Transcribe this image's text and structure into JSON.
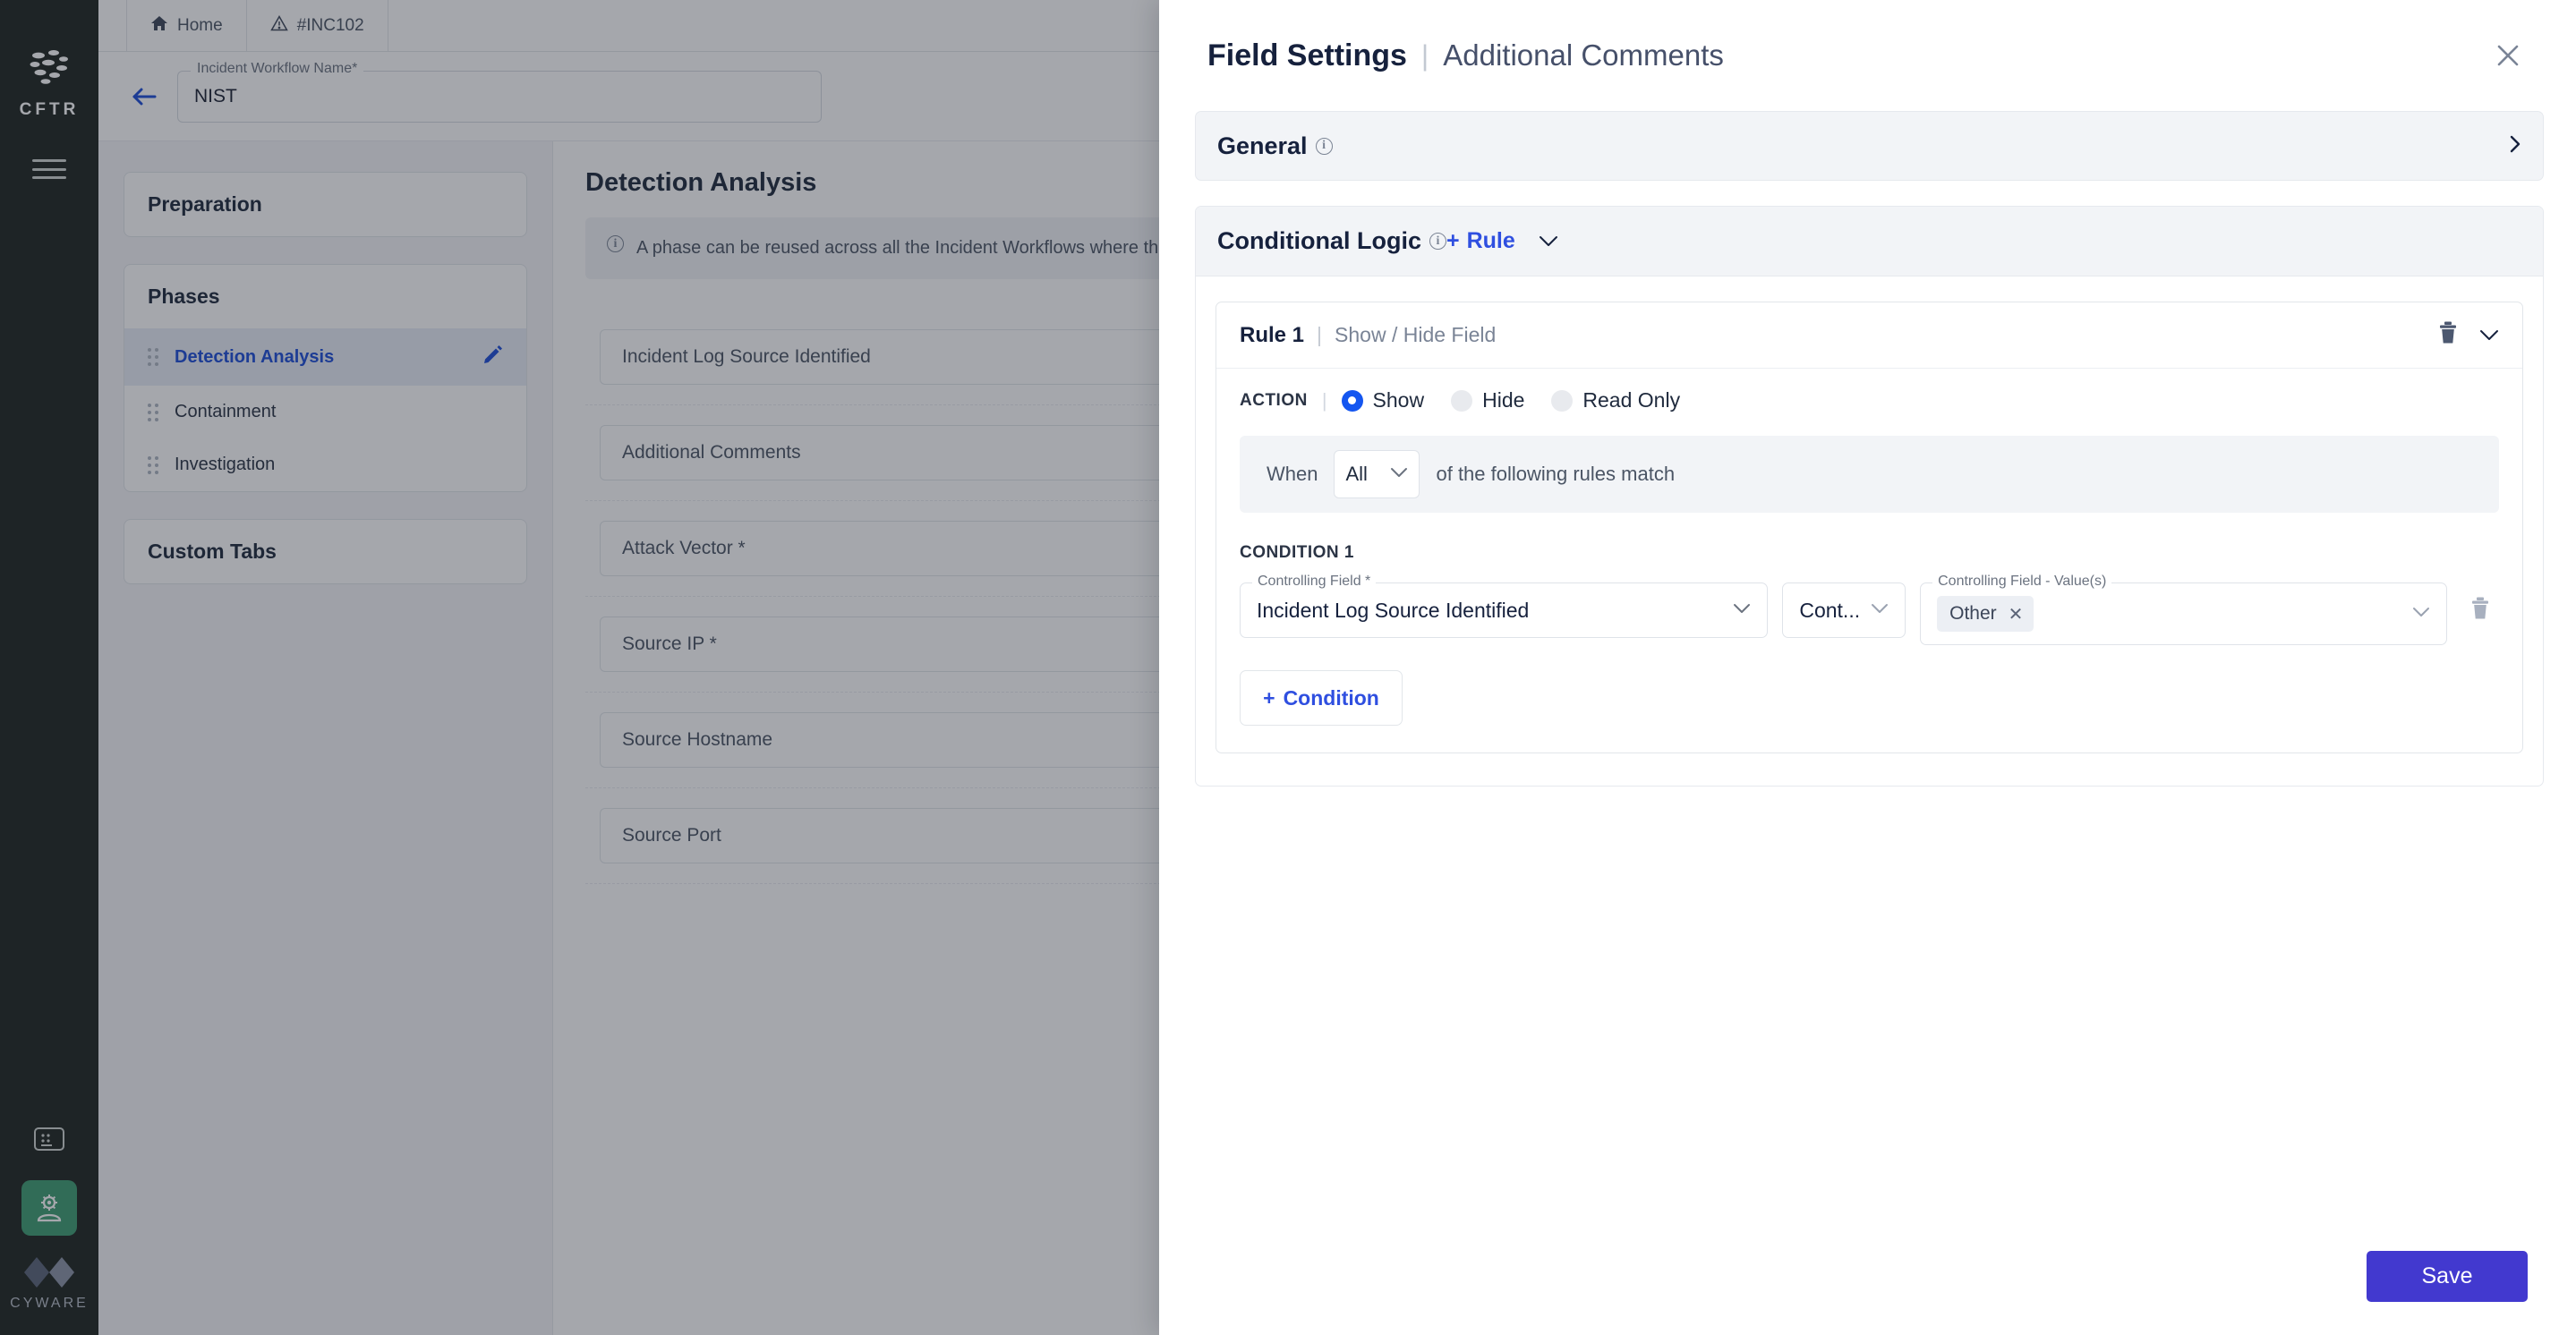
{
  "rail": {
    "logo_text": "CFTR",
    "logo_icon": "cluster-logo-icon",
    "menu_icon": "hamburger-menu-icon",
    "items": [
      {
        "icon": "console-icon",
        "active": false
      },
      {
        "icon": "admin-settings-icon",
        "active": true
      }
    ],
    "brand_text": "CYWARE",
    "brand_icon": "cyware-logo-icon"
  },
  "topbar": {
    "tabs": [
      {
        "label": "Home",
        "icon": "home-icon"
      },
      {
        "label": "#INC102",
        "icon": "warning-triangle-icon"
      }
    ]
  },
  "workflow": {
    "back_icon": "back-arrow-icon",
    "name_label": "Incident Workflow Name*",
    "name_value": "NIST"
  },
  "left_panel": {
    "preparation_label": "Preparation",
    "phases_label": "Phases",
    "phases": [
      {
        "label": "Detection Analysis",
        "selected": true,
        "edit_icon": "pencil-icon"
      },
      {
        "label": "Containment",
        "selected": false
      },
      {
        "label": "Investigation",
        "selected": false
      }
    ],
    "custom_tabs_label": "Custom Tabs"
  },
  "main": {
    "heading": "Detection Analysis",
    "info_icon": "info-circle-icon",
    "info_text": "A phase can be reused across all the Incident Workflows where this phase is used.",
    "fields": [
      "Incident Log Source Identified",
      "Additional Comments",
      "Attack Vector *",
      "Source IP *",
      "Source Hostname",
      "Source Port"
    ]
  },
  "panel": {
    "title": "Field Settings",
    "separator": "|",
    "subtitle": "Additional Comments",
    "close_icon": "close-icon",
    "general": {
      "label": "General",
      "info_icon": "info-circle-icon",
      "expand_icon": "chevron-right-icon"
    },
    "conditional_logic": {
      "label": "Conditional Logic",
      "info_icon": "info-circle-icon",
      "add_rule_label": "Rule",
      "add_rule_plus": "+",
      "collapse_icon": "chevron-down-icon"
    },
    "rule": {
      "name": "Rule 1",
      "separator": "|",
      "subtitle": "Show / Hide Field",
      "delete_icon": "trash-icon",
      "collapse_icon": "chevron-down-icon",
      "action_label": "ACTION",
      "action_divider": "|",
      "action_options": [
        {
          "label": "Show",
          "selected": true
        },
        {
          "label": "Hide",
          "selected": false
        },
        {
          "label": "Read Only",
          "selected": false
        }
      ],
      "when_prefix": "When",
      "when_value": "All",
      "when_chevron_icon": "chevron-down-icon",
      "when_suffix": "of the following rules match",
      "condition_header": "CONDITION 1",
      "condition": {
        "field_legend": "Controlling Field *",
        "field_value": "Incident Log Source Identified",
        "field_chevron_icon": "chevron-down-icon",
        "operator_value": "Cont...",
        "operator_chevron_icon": "chevron-down-icon",
        "values_legend": "Controlling Field - Value(s)",
        "values_chips": [
          {
            "label": "Other",
            "remove_icon": "close-icon"
          }
        ],
        "values_chevron_icon": "chevron-down-icon",
        "delete_icon": "trash-icon"
      },
      "add_condition_label": "Condition",
      "add_condition_plus": "+"
    },
    "save_label": "Save"
  },
  "colors": {
    "accent_blue": "#2f4fe0",
    "radio_blue": "#1456f0",
    "save_purple": "#4239cf",
    "rail_dark": "#1f2621",
    "rail_active_green": "#3f9d72",
    "heading_navy": "#16213d"
  }
}
